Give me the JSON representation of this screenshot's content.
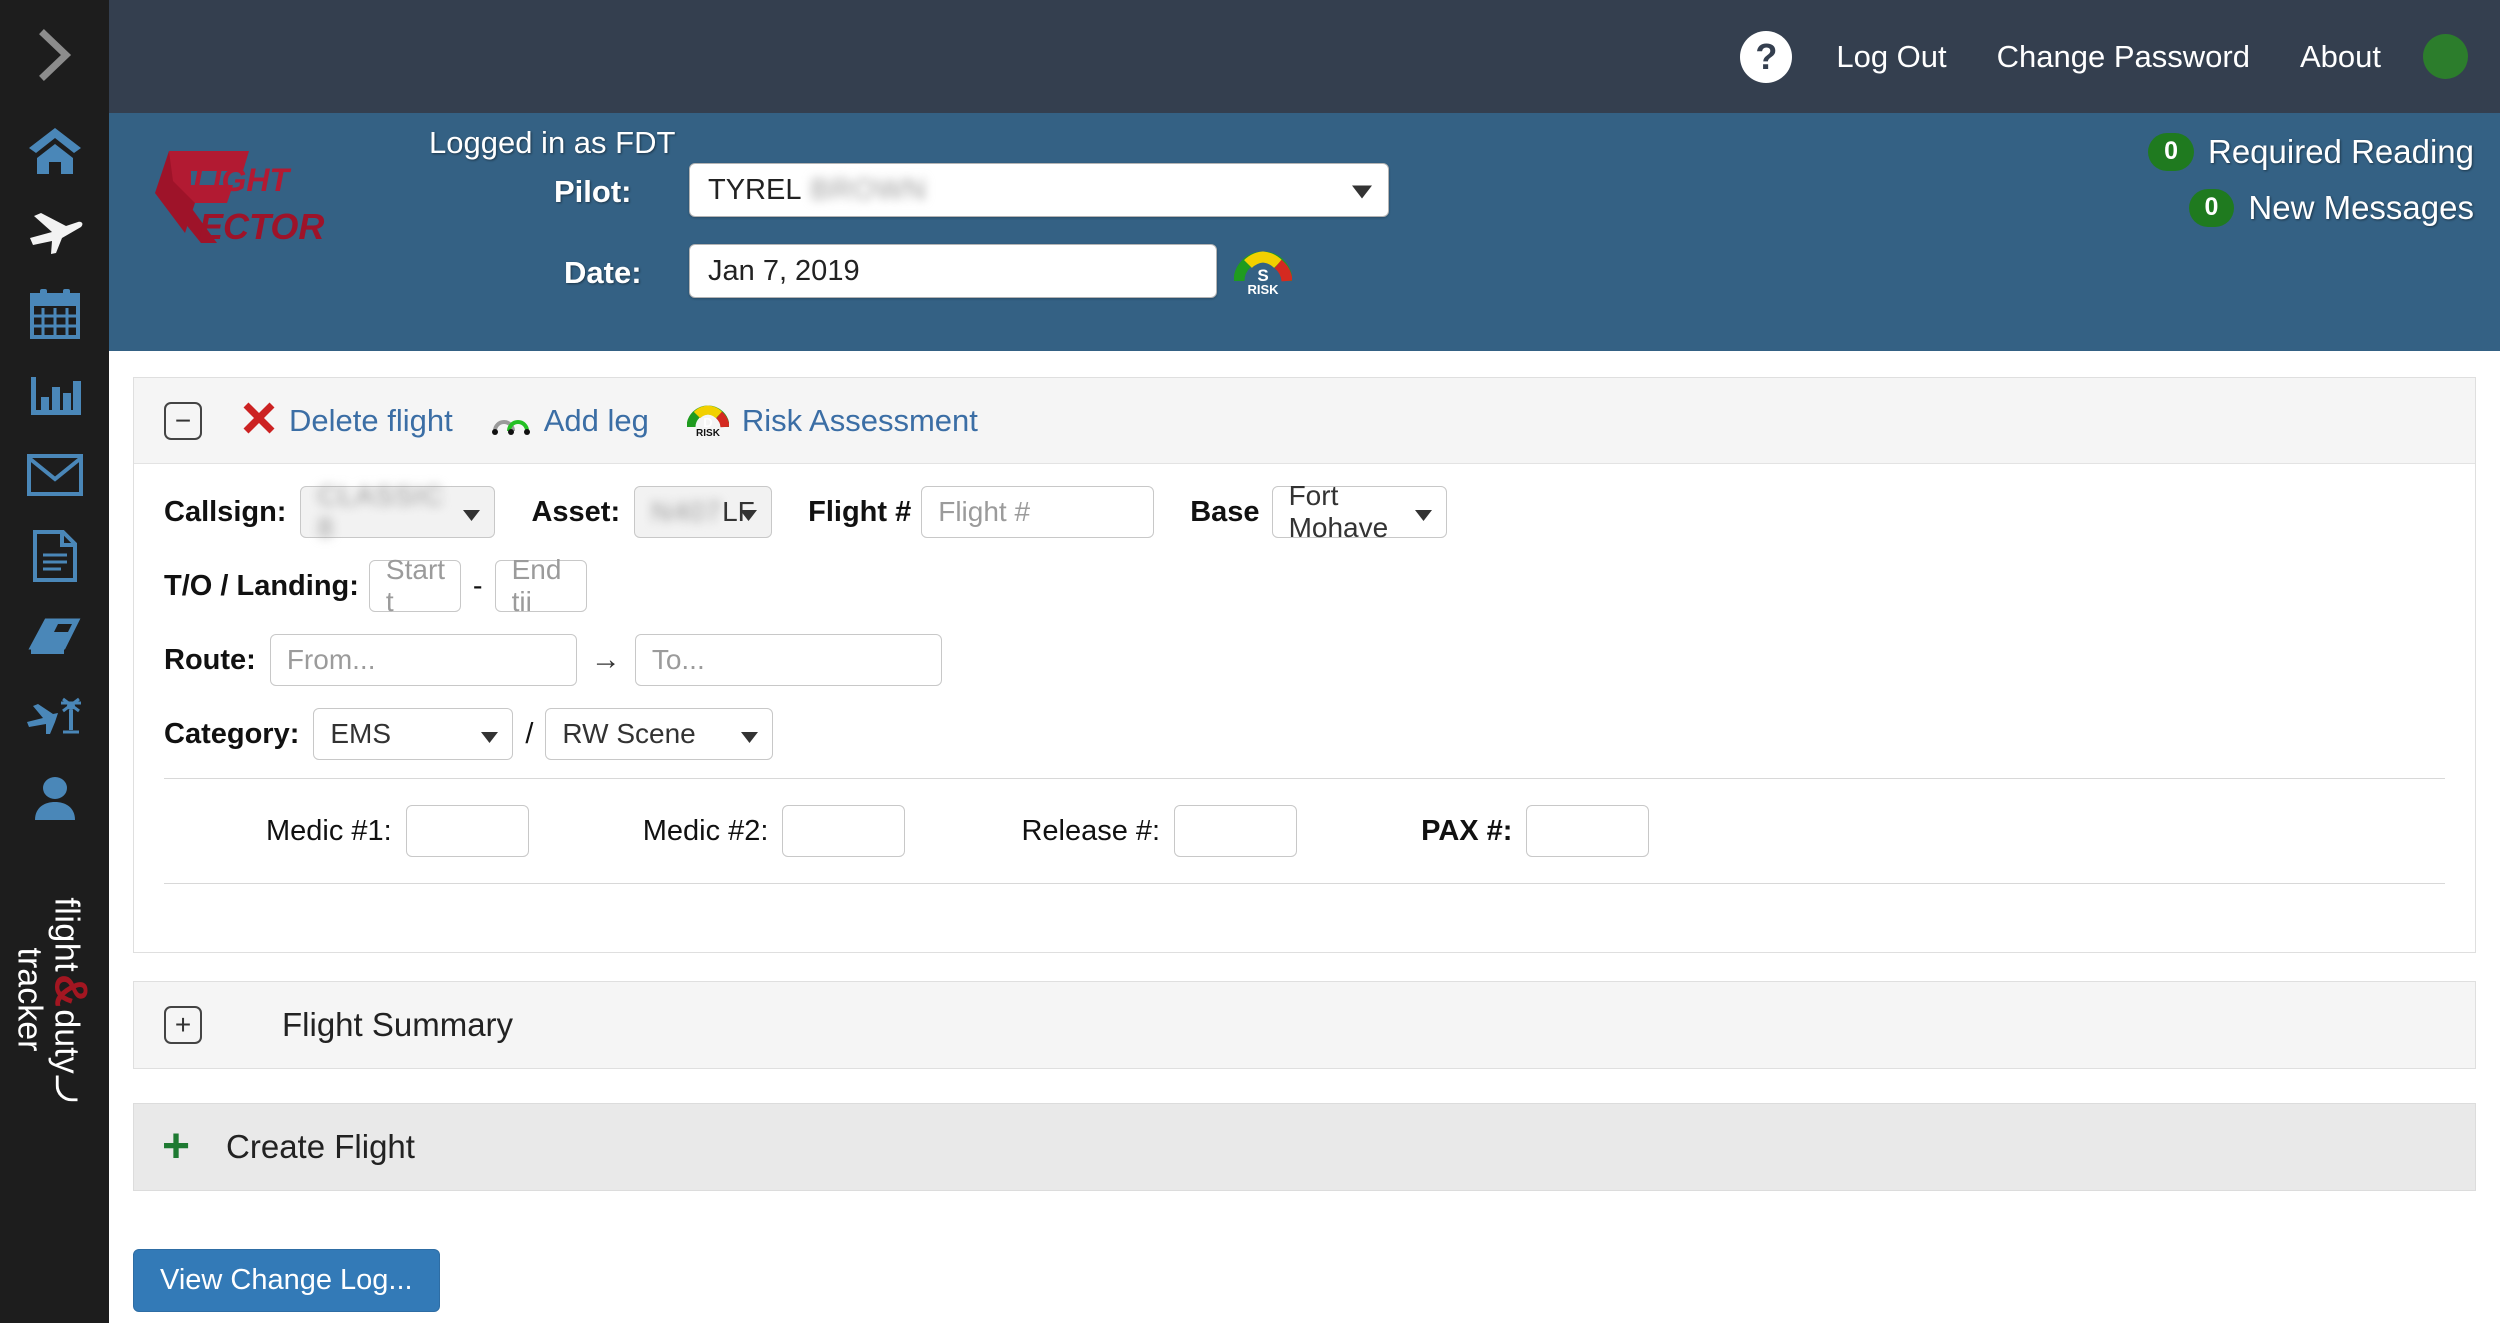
{
  "sidebar": {
    "toggle_icon": "chevron-right-icon",
    "items": [
      {
        "icon": "home-icon",
        "active": false
      },
      {
        "icon": "airplane-icon",
        "active": true
      },
      {
        "icon": "calendar-icon",
        "active": false
      },
      {
        "icon": "bar-chart-icon",
        "active": false
      },
      {
        "icon": "envelope-icon",
        "active": false
      },
      {
        "icon": "document-icon",
        "active": false
      },
      {
        "icon": "book-icon",
        "active": false
      },
      {
        "icon": "aircraft-fleet-icon",
        "active": false
      },
      {
        "icon": "person-icon",
        "active": false
      }
    ],
    "brand": {
      "word1": "flight",
      "amp": "&",
      "word2": "duty",
      "word3": "tracker",
      "amp_color": "#a31621"
    }
  },
  "topbar": {
    "help_icon": "question-mark-icon",
    "links": [
      {
        "label": "Log Out"
      },
      {
        "label": "Change Password"
      },
      {
        "label": "About"
      }
    ],
    "status_dot_color": "#2c7d2c"
  },
  "header": {
    "logo_line1": "FLIGHT",
    "logo_line2": "VECTOR",
    "logo_color": "#b21a32",
    "logged_in_as": "Logged in as FDT",
    "pilot_label": "Pilot:",
    "pilot_value": "TYREL",
    "pilot_value_redacted": "BROWN",
    "date_label": "Date:",
    "date_value": "Jan 7, 2019",
    "risk_icon": "risk-gauge-icon",
    "required_reading": {
      "count": "0",
      "label": "Required Reading"
    },
    "new_messages": {
      "count": "0",
      "label": "New Messages"
    }
  },
  "flight_panel": {
    "collapse_icon": "minus-box-icon",
    "tools": [
      {
        "icon": "red-x-icon",
        "label": "Delete flight"
      },
      {
        "icon": "add-leg-arc-icon",
        "label": "Add leg"
      },
      {
        "icon": "risk-gauge-icon",
        "label": "Risk Assessment"
      }
    ],
    "callsign": {
      "label": "Callsign:",
      "value": "CLASSIC 8",
      "redacted": true
    },
    "asset": {
      "label": "Asset:",
      "value_redacted": "N407",
      "value_visible": "LF"
    },
    "flight_no": {
      "label": "Flight #",
      "placeholder": "Flight #",
      "value": ""
    },
    "base": {
      "label": "Base",
      "value": "Fort Mohave"
    },
    "takeoff_landing": {
      "label": "T/O / Landing:",
      "start_placeholder": "Start t",
      "end_placeholder": "End tii",
      "separator": "-"
    },
    "route": {
      "label": "Route:",
      "from_placeholder": "From...",
      "to_placeholder": "To...",
      "arrow": "→"
    },
    "category": {
      "label": "Category:",
      "value1": "EMS",
      "separator": "/",
      "value2": "RW Scene"
    },
    "crew": [
      {
        "label": "Medic #1:",
        "value": "",
        "bold": false
      },
      {
        "label": "Medic #2:",
        "value": "",
        "bold": false
      },
      {
        "label": "Release #:",
        "value": "",
        "bold": false
      },
      {
        "label": "PAX #:",
        "value": "",
        "bold": true
      }
    ]
  },
  "summary_panel": {
    "expand_icon": "plus-box-icon",
    "title": "Flight Summary"
  },
  "create_panel": {
    "plus_icon": "plus-icon",
    "title": "Create Flight"
  },
  "footer": {
    "change_log_label": "View Change Log..."
  }
}
